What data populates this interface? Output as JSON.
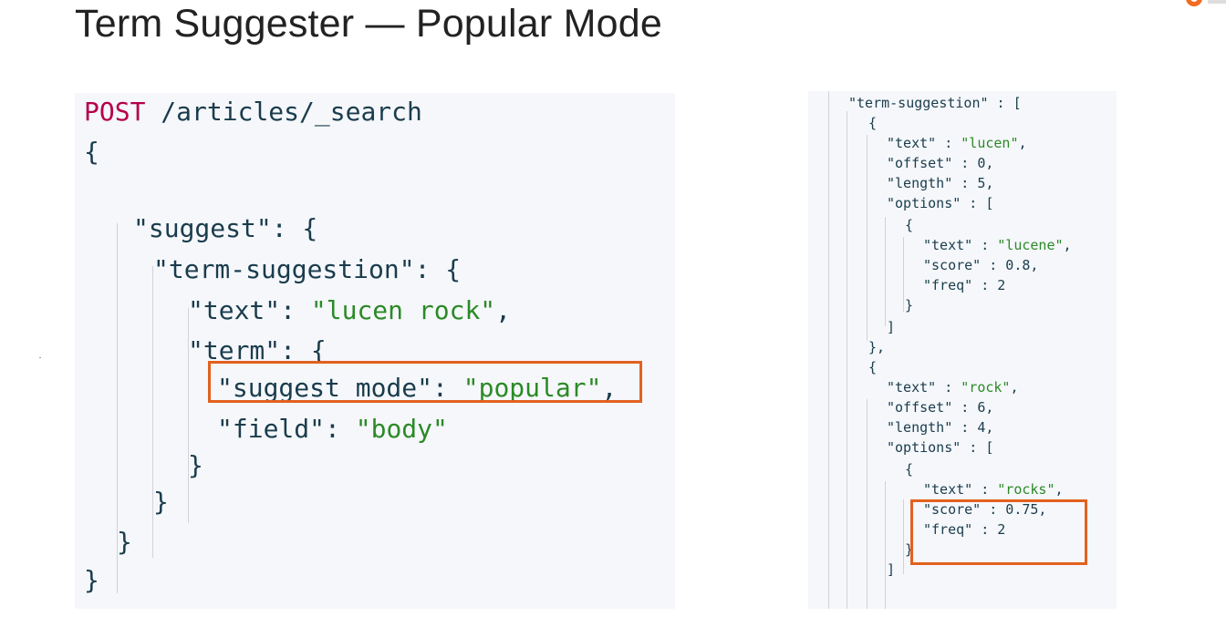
{
  "slide": {
    "title": "Term Suggester — Popular Mode"
  },
  "request": {
    "method": "POST",
    "path": " /articles/_search",
    "lines": {
      "open_brace": "{",
      "suggest_key": "\"suggest\"",
      "suggest_rest": ": {",
      "term_suggestion_key": "\"term-suggestion\"",
      "term_suggestion_rest": ": {",
      "text_key": "\"text\"",
      "text_colon": ": ",
      "text_value": "\"lucen rock\"",
      "text_comma": ",",
      "term_key": "\"term\"",
      "term_rest": ": {",
      "suggest_mode_key": "\"suggest_mode\"",
      "suggest_mode_colon": ": ",
      "suggest_mode_value": "\"popular\"",
      "suggest_mode_comma": ",",
      "field_key": "\"field\"",
      "field_colon": ": ",
      "field_value": "\"body\"",
      "close1": "}",
      "close2": "}",
      "close3": "}",
      "close4": "}"
    }
  },
  "response": {
    "lines": {
      "header": "\"term-suggestion\" : [",
      "o1_open": "{",
      "o1_text_key": "\"text\" : ",
      "o1_text_val": "\"lucen\"",
      "o1_text_comma": ",",
      "o1_offset": "\"offset\" : 0,",
      "o1_length": "\"length\" : 5,",
      "o1_options": "\"options\" : [",
      "o1_opt_open": "{",
      "o1_opt_text_key": "\"text\" : ",
      "o1_opt_text_val": "\"lucene\"",
      "o1_opt_text_comma": ",",
      "o1_opt_score": "\"score\" : 0.8,",
      "o1_opt_freq": "\"freq\" : 2",
      "o1_opt_close": "}",
      "o1_opts_close": "]",
      "o1_close": "},",
      "o2_open": "{",
      "o2_text_key": "\"text\" : ",
      "o2_text_val": "\"rock\"",
      "o2_text_comma": ",",
      "o2_offset": "\"offset\" : 6,",
      "o2_length": "\"length\" : 4,",
      "o2_options": "\"options\" : [",
      "o2_opt_open": "{",
      "o2_opt_text_key": "\"text\" : ",
      "o2_opt_text_val": "\"rocks\"",
      "o2_opt_text_comma": ",",
      "o2_opt_score": "\"score\" : 0.75,",
      "o2_opt_freq": "\"freq\" : 2",
      "o2_opt_close": "}",
      "o2_opts_close": "]"
    }
  },
  "colors": {
    "highlight": "#e2611f",
    "keyword": "#b5004a",
    "string": "#2b8a26",
    "text": "#1a3c4d",
    "panel_bg": "#f5f7fa"
  }
}
